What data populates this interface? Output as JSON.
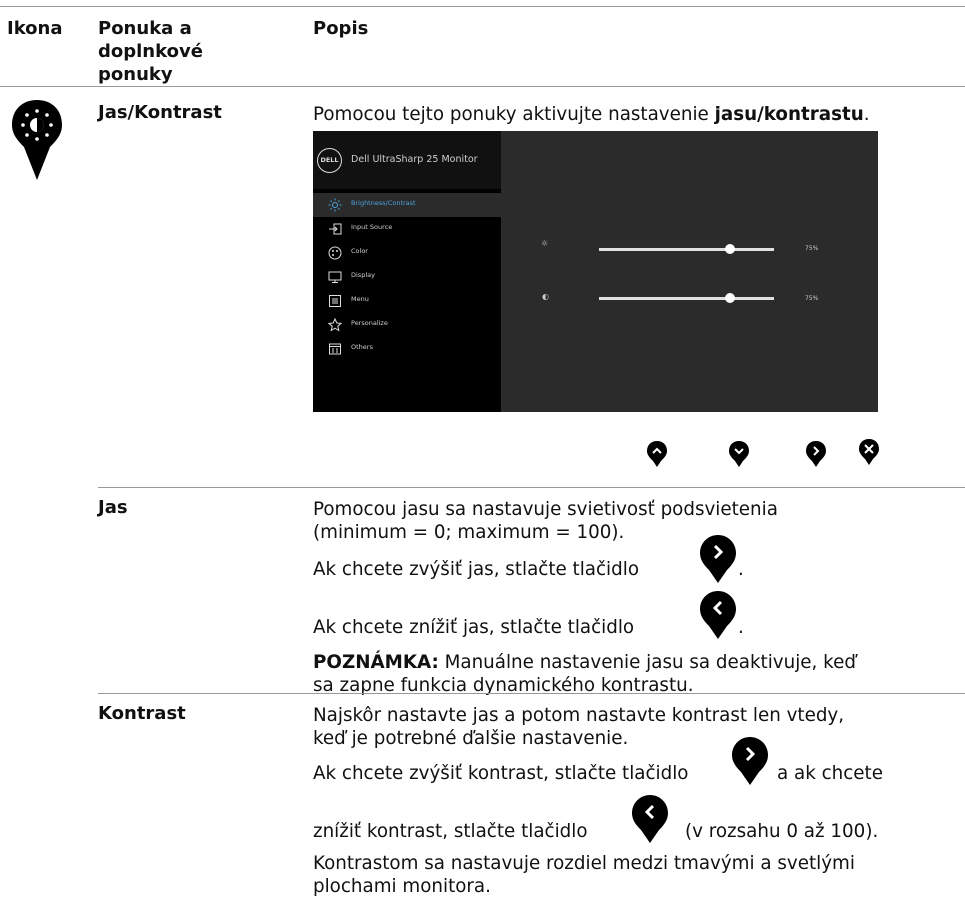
{
  "header": {
    "col1": "Ikona",
    "col2": [
      "Ponuka a",
      "doplnkové",
      "ponuky"
    ],
    "col3": "Popis"
  },
  "section_title": "Jas/Kontrast",
  "intro": {
    "before": "Pomocou tejto ponuky aktivujte nastavenie ",
    "bold": "jasu/kontrastu",
    "after": "."
  },
  "osd": {
    "logo": "DELL",
    "title": "Dell UltraSharp 25 Monitor",
    "menu": [
      {
        "label": "Brightness/Contrast",
        "icon": "brightness-icon",
        "selected": true
      },
      {
        "label": "Input Source",
        "icon": "input-source-icon",
        "selected": false
      },
      {
        "label": "Color",
        "icon": "color-icon",
        "selected": false
      },
      {
        "label": "Display",
        "icon": "display-icon",
        "selected": false
      },
      {
        "label": "Menu",
        "icon": "menu-icon",
        "selected": false
      },
      {
        "label": "Personalize",
        "icon": "star-icon",
        "selected": false
      },
      {
        "label": "Others",
        "icon": "others-icon",
        "selected": false
      }
    ],
    "sliders": [
      {
        "name": "brightness",
        "value": 75,
        "label": "75%"
      },
      {
        "name": "contrast",
        "value": 75,
        "label": "75%"
      }
    ],
    "accent_color": "#4aa3df",
    "buttons": [
      "up-arrow-icon",
      "down-arrow-icon",
      "right-arrow-icon",
      "close-icon"
    ]
  },
  "rows": {
    "jas": {
      "name": "Jas",
      "desc_line1": "Pomocou jasu sa nastavuje svietivosť podsvietenia",
      "desc_line2": "(minimum = 0; maximum = 100).",
      "increase": "Ak chcete zvýšiť jas, stlačte tlačidlo",
      "decrease": "Ak chcete znížiť jas, stlačte tlačidlo",
      "period": ".",
      "note_label": "POZNÁMKA:",
      "note_line1": " Manuálne nastavenie jasu sa deaktivuje, keď",
      "note_line2": "sa zapne funkcia dynamického kontrastu."
    },
    "kontrast": {
      "name": "Kontrast",
      "line1": "Najskôr nastavte jas a potom nastavte kontrast len vtedy,",
      "line2": "keď je potrebné ďalšie nastavenie.",
      "inc_before": "Ak chcete zvýšiť kontrast, stlačte tlačidlo",
      "inc_after": "a ak chcete",
      "dec_before": "znížiť kontrast, stlačte tlačidlo",
      "dec_after": "(v rozsahu 0 až 100).",
      "line5": "Kontrastom sa nastavuje rozdiel medzi tmavými a svetlými",
      "line6": "plochami monitora."
    }
  }
}
